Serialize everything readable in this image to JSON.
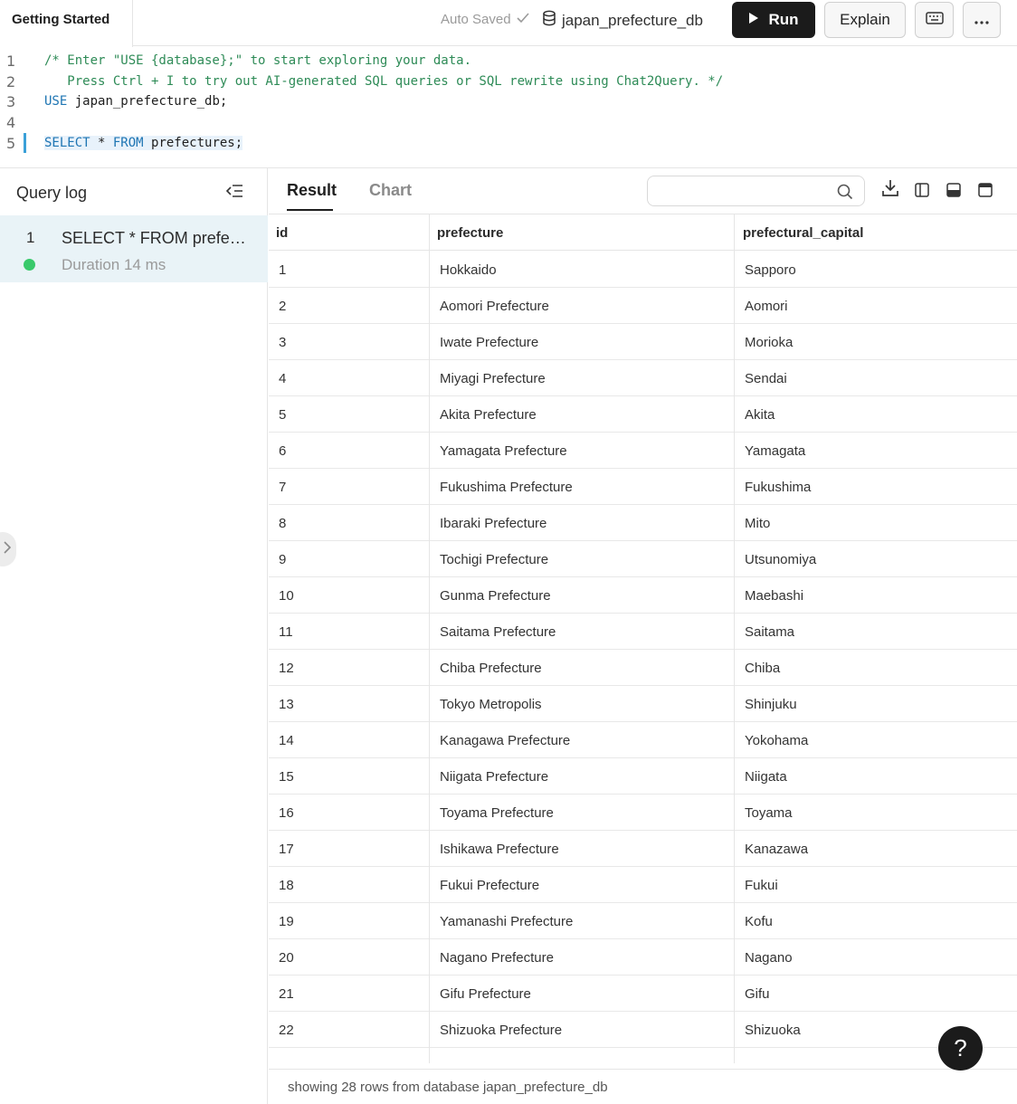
{
  "header": {
    "tab_title": "Getting Started",
    "auto_saved": "Auto Saved",
    "database": "japan_prefecture_db",
    "run_label": "Run",
    "explain_label": "Explain"
  },
  "editor": {
    "lines": [
      {
        "num": "1",
        "text": "/* Enter \"USE {database};\" to start exploring your data."
      },
      {
        "num": "2",
        "text": "   Press Ctrl + I to try out AI-generated SQL queries or SQL rewrite using Chat2Query. */"
      },
      {
        "num": "3",
        "kw": "USE",
        "text": " japan_prefecture_db;"
      },
      {
        "num": "4",
        "text": ""
      },
      {
        "num": "5",
        "kw": "SELECT",
        "text_mid": " * ",
        "kw2": "FROM",
        "text": " prefectures;"
      }
    ]
  },
  "query_log": {
    "title": "Query log",
    "items": [
      {
        "num": "1",
        "query": "SELECT * FROM prefectures;",
        "duration": "Duration 14 ms"
      }
    ]
  },
  "result_tabs": {
    "result": "Result",
    "chart": "Chart",
    "search_placeholder": ""
  },
  "table": {
    "columns": [
      "id",
      "prefecture",
      "prefectural_capital"
    ],
    "rows": [
      [
        "1",
        "Hokkaido",
        "Sapporo"
      ],
      [
        "2",
        "Aomori Prefecture",
        "Aomori"
      ],
      [
        "3",
        "Iwate Prefecture",
        "Morioka"
      ],
      [
        "4",
        "Miyagi Prefecture",
        "Sendai"
      ],
      [
        "5",
        "Akita Prefecture",
        "Akita"
      ],
      [
        "6",
        "Yamagata Prefecture",
        "Yamagata"
      ],
      [
        "7",
        "Fukushima Prefecture",
        "Fukushima"
      ],
      [
        "8",
        "Ibaraki Prefecture",
        "Mito"
      ],
      [
        "9",
        "Tochigi Prefecture",
        "Utsunomiya"
      ],
      [
        "10",
        "Gunma Prefecture",
        "Maebashi"
      ],
      [
        "11",
        "Saitama Prefecture",
        "Saitama"
      ],
      [
        "12",
        "Chiba Prefecture",
        "Chiba"
      ],
      [
        "13",
        "Tokyo Metropolis",
        "Shinjuku"
      ],
      [
        "14",
        "Kanagawa Prefecture",
        "Yokohama"
      ],
      [
        "15",
        "Niigata Prefecture",
        "Niigata"
      ],
      [
        "16",
        "Toyama Prefecture",
        "Toyama"
      ],
      [
        "17",
        "Ishikawa Prefecture",
        "Kanazawa"
      ],
      [
        "18",
        "Fukui Prefecture",
        "Fukui"
      ],
      [
        "19",
        "Yamanashi Prefecture",
        "Kofu"
      ],
      [
        "20",
        "Nagano Prefecture",
        "Nagano"
      ],
      [
        "21",
        "Gifu Prefecture",
        "Gifu"
      ],
      [
        "22",
        "Shizuoka Prefecture",
        "Shizuoka"
      ]
    ]
  },
  "footer": {
    "status": "showing 28 rows from database japan_prefecture_db"
  },
  "help": {
    "label": "?"
  }
}
